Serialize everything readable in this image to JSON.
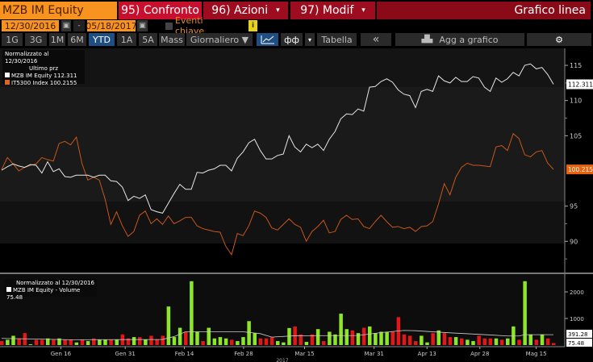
{
  "header": {
    "ticker": "MZB IM Equity",
    "compare": "95) Confronto",
    "actions": "96) Azioni",
    "edit": "97) Modif",
    "chart_type": "Grafico linea",
    "dropdown": "▾"
  },
  "dates": {
    "start": "12/30/2016",
    "sep": "-",
    "end": "05/18/2017",
    "events_label": "Eventi chiave",
    "info": "i"
  },
  "toolbar": {
    "periods": [
      "1G",
      "3G",
      "1M",
      "6M",
      "YTD",
      "1A",
      "5A",
      "Mass"
    ],
    "selected": "YTD",
    "frequency": "Giornaliero ▼",
    "table": "Tabella",
    "collapse": "«",
    "add_to_chart": "Agg a grafico"
  },
  "colors": {
    "white_series": "#e8e8e8",
    "orange_series": "#d2601a",
    "up": "#8ee62a",
    "down": "#e01818"
  },
  "chart_data": [
    {
      "type": "line",
      "title": "Normalizzato al 12/30/2016",
      "subtitle": "Ultimo prz",
      "ylim": [
        86,
        118
      ],
      "yticks": [
        90,
        95,
        105,
        110,
        115
      ],
      "series": [
        {
          "name": "MZB IM Equity",
          "last": "112.311",
          "values": [
            100.1,
            100.6,
            101.0,
            100.7,
            100.5,
            100.9,
            100.8,
            99.7,
            101.3,
            99.9,
            100.3,
            99.2,
            99.1,
            99.4,
            99.4,
            99.4,
            99.1,
            99.4,
            99.4,
            98.6,
            98.5,
            97.7,
            95.8,
            96.4,
            96.1,
            96.6,
            94.5,
            94.2,
            94.0,
            95.4,
            96.8,
            98.1,
            97.4,
            97.4,
            99.8,
            99.7,
            100.1,
            100.3,
            100.8,
            100.8,
            100.0,
            101.8,
            102.7,
            104.0,
            104.5,
            102.9,
            101.7,
            101.7,
            102.2,
            102.4,
            105.0,
            103.4,
            102.7,
            103.8,
            103.3,
            103.8,
            102.9,
            104.5,
            105.6,
            107.4,
            108.1,
            108.0,
            108.8,
            108.5,
            111.9,
            112.0,
            112.7,
            113.1,
            112.6,
            111.5,
            110.9,
            110.7,
            109.0,
            111.3,
            111.6,
            111.3,
            113.5,
            112.8,
            112.5,
            113.3,
            112.7,
            112.7,
            113.4,
            113.2,
            111.9,
            111.3,
            113.2,
            112.6,
            113.1,
            114.0,
            113.5,
            115.0,
            115.2,
            114.5,
            114.7,
            113.7,
            112.311
          ]
        },
        {
          "name": "IT5300 Index",
          "last": "100.2155",
          "values": [
            100.2,
            101.9,
            101.0,
            100.0,
            100.5,
            100.8,
            101.0,
            101.9,
            101.6,
            101.4,
            103.9,
            104.2,
            103.7,
            104.8,
            101.0,
            98.7,
            99.1,
            98.7,
            96.0,
            92.4,
            94.2,
            92.2,
            90.7,
            91.4,
            93.7,
            94.3,
            92.5,
            93.2,
            92.4,
            93.6,
            92.5,
            92.9,
            93.4,
            93.4,
            92.2,
            91.8,
            91.6,
            91.4,
            91.3,
            89.3,
            88.1,
            91.1,
            90.8,
            92.2,
            94.3,
            94.0,
            93.4,
            91.9,
            91.6,
            92.4,
            93.2,
            92.4,
            92.0,
            90.0,
            91.4,
            92.1,
            93.0,
            91.2,
            91.4,
            93.1,
            93.7,
            93.1,
            93.2,
            92.1,
            91.8,
            92.8,
            93.7,
            92.8,
            92.0,
            92.1,
            91.8,
            92.0,
            91.4,
            92.1,
            92.2,
            92.8,
            95.3,
            98.2,
            96.6,
            99.1,
            100.5,
            101.1,
            100.8,
            100.8,
            100.7,
            100.6,
            103.4,
            103.6,
            102.9,
            105.3,
            104.6,
            102.3,
            102.0,
            102.7,
            102.9,
            101.1,
            100.2155
          ]
        }
      ],
      "legend": {
        "line1": "MZB IM Equity  112.311",
        "line2": "IT5300 Index   100.2155"
      }
    },
    {
      "type": "bar",
      "title": "Normalizzato al 12/30/2016",
      "legend": "MZB IM Equity - Volume 75.48",
      "ylim": [
        0,
        2700
      ],
      "yticks": [
        1000,
        2000
      ],
      "ma_label": "391.28",
      "last_label": "75.48",
      "volume": [
        150,
        200,
        350,
        250,
        450,
        30,
        200,
        200,
        250,
        200,
        250,
        200,
        200,
        100,
        200,
        150,
        250,
        200,
        200,
        200,
        200,
        400,
        250,
        300,
        300,
        200,
        350,
        200,
        350,
        1450,
        300,
        650,
        500,
        2400,
        500,
        150,
        650,
        250,
        300,
        250,
        200,
        150,
        300,
        900,
        450,
        250,
        250,
        300,
        150,
        100,
        640,
        700,
        400,
        120,
        400,
        600,
        150,
        500,
        400,
        1180,
        600,
        550,
        450,
        650,
        700,
        450,
        500,
        500,
        500,
        1050,
        400,
        350,
        150,
        350,
        100,
        450,
        550,
        450,
        300,
        300,
        250,
        200,
        150,
        350,
        250,
        250,
        250,
        200,
        250,
        700,
        200,
        2400,
        400,
        200,
        400,
        250,
        75.48
      ],
      "up": [
        0,
        1,
        1,
        0,
        0,
        1,
        0,
        0,
        1,
        0,
        1,
        0,
        0,
        1,
        0,
        1,
        0,
        1,
        1,
        0,
        1,
        0,
        0,
        1,
        0,
        1,
        0,
        0,
        0,
        1,
        1,
        1,
        0,
        1,
        1,
        0,
        1,
        1,
        1,
        1,
        0,
        1,
        1,
        1,
        1,
        0,
        0,
        0,
        1,
        1,
        1,
        0,
        0,
        1,
        0,
        1,
        0,
        1,
        1,
        1,
        1,
        0,
        1,
        0,
        1,
        1,
        1,
        1,
        0,
        0,
        0,
        0,
        0,
        1,
        1,
        0,
        1,
        0,
        0,
        1,
        0,
        1,
        1,
        0,
        0,
        0,
        1,
        0,
        1,
        1,
        0,
        1,
        1,
        0,
        1,
        0,
        0
      ],
      "ma": [
        [
          0,
          250
        ],
        [
          5,
          230
        ],
        [
          12,
          200
        ],
        [
          28,
          210
        ],
        [
          30,
          320
        ],
        [
          32,
          500
        ],
        [
          42,
          500
        ],
        [
          45,
          430
        ],
        [
          47,
          300
        ],
        [
          51,
          350
        ],
        [
          62,
          360
        ],
        [
          66,
          470
        ],
        [
          70,
          550
        ],
        [
          72,
          540
        ],
        [
          78,
          460
        ],
        [
          85,
          380
        ],
        [
          88,
          340
        ],
        [
          90,
          340
        ],
        [
          91,
          391.28
        ],
        [
          96,
          391.28
        ]
      ],
      "xticks": [
        {
          "day": 10.3,
          "label": "Gen 16"
        },
        {
          "day": 21.5,
          "label": "Gen 31"
        },
        {
          "day": 31.8,
          "label": "Feb 14"
        },
        {
          "day": 42.1,
          "label": "Feb 28"
        },
        {
          "day": 52.7,
          "label": "Mar 15"
        },
        {
          "day": 64.8,
          "label": "Mar 31"
        },
        {
          "day": 74,
          "label": "Apr 13"
        },
        {
          "day": 83.2,
          "label": "Apr 28"
        },
        {
          "day": 93,
          "label": "Mag 15"
        }
      ],
      "year": "2017"
    }
  ]
}
